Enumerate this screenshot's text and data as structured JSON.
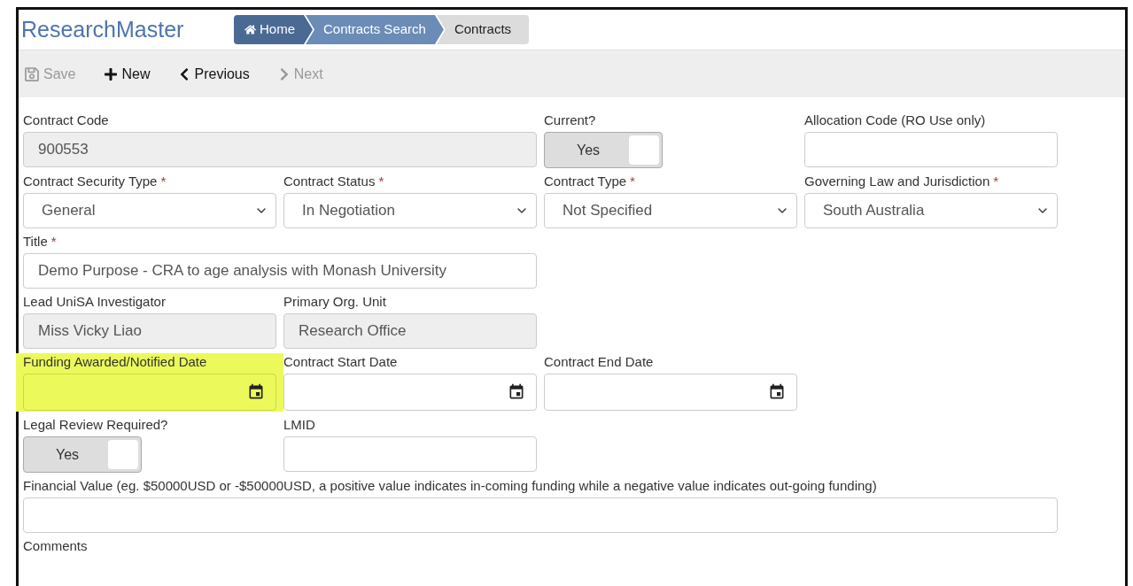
{
  "app_title": "ResearchMaster",
  "breadcrumb": [
    {
      "label": "Home",
      "kind": "home",
      "selected": false
    },
    {
      "label": "Contracts Search",
      "kind": "link",
      "selected": false
    },
    {
      "label": "Contracts",
      "kind": "link",
      "selected": true
    }
  ],
  "toolbar": [
    {
      "label": "Save",
      "kind": "save",
      "disabled": true
    },
    {
      "label": "New",
      "kind": "new",
      "disabled": false
    },
    {
      "label": "Previous",
      "kind": "previous",
      "disabled": false
    },
    {
      "label": "Next",
      "kind": "next",
      "disabled": true
    }
  ],
  "rows": [
    {
      "fields": [
        {
          "label": "Contract Code",
          "kind": "readonly",
          "value": "900553",
          "highlighted": false
        },
        {
          "label": "Current?",
          "kind": "toggle",
          "value": "Yes",
          "on": true,
          "highlighted": false
        },
        {
          "label": "Allocation Code (RO Use only)",
          "kind": "text",
          "highlighted": false
        }
      ]
    },
    {
      "fields": [
        {
          "label": "Contract Security Type",
          "required_mark": "*",
          "kind": "select",
          "value": "General",
          "highlighted": false
        },
        {
          "label": "Contract Status",
          "required_mark": "*",
          "kind": "select",
          "value": "In Negotiation",
          "highlighted": false
        },
        {
          "label": "Contract Type",
          "required_mark": "*",
          "kind": "select",
          "value": "Not Specified",
          "highlighted": false
        },
        {
          "label": "Governing Law and Jurisdiction",
          "required_mark": "*",
          "kind": "select",
          "value": "South Australia",
          "highlighted": false
        }
      ]
    },
    {
      "fields": [
        {
          "label": "Title",
          "required_mark": "*",
          "kind": "text",
          "value": "Demo Purpose - CRA to age analysis with Monash University",
          "highlighted": false
        }
      ]
    },
    {
      "fields": [
        {
          "label": "Lead UniSA Investigator",
          "kind": "readonly",
          "value": "Miss Vicky Liao",
          "highlighted": false
        },
        {
          "label": "Primary Org. Unit",
          "kind": "readonly",
          "value": "Research Office",
          "highlighted": false
        }
      ]
    },
    {
      "fields": [
        {
          "label": "Funding Awarded/Notified Date",
          "kind": "date",
          "highlighted": true
        },
        {
          "label": "Contract Start Date",
          "kind": "date",
          "highlighted": false
        },
        {
          "label": "Contract End Date",
          "kind": "date",
          "highlighted": false
        }
      ]
    },
    {
      "fields": [
        {
          "label": "Legal Review Required?",
          "kind": "toggle",
          "value": "Yes",
          "on": true,
          "highlighted": false
        },
        {
          "label": "LMID",
          "kind": "text",
          "highlighted": false
        }
      ]
    },
    {
      "fields": [
        {
          "label": "Financial Value (eg. $50000USD or -$50000USD, a positive value indicates in-coming funding while a negative value indicates out-going funding)",
          "kind": "text",
          "highlighted": false
        }
      ]
    },
    {
      "fields": [
        {
          "label": "Comments",
          "kind": "label",
          "highlighted": false
        }
      ]
    }
  ]
}
